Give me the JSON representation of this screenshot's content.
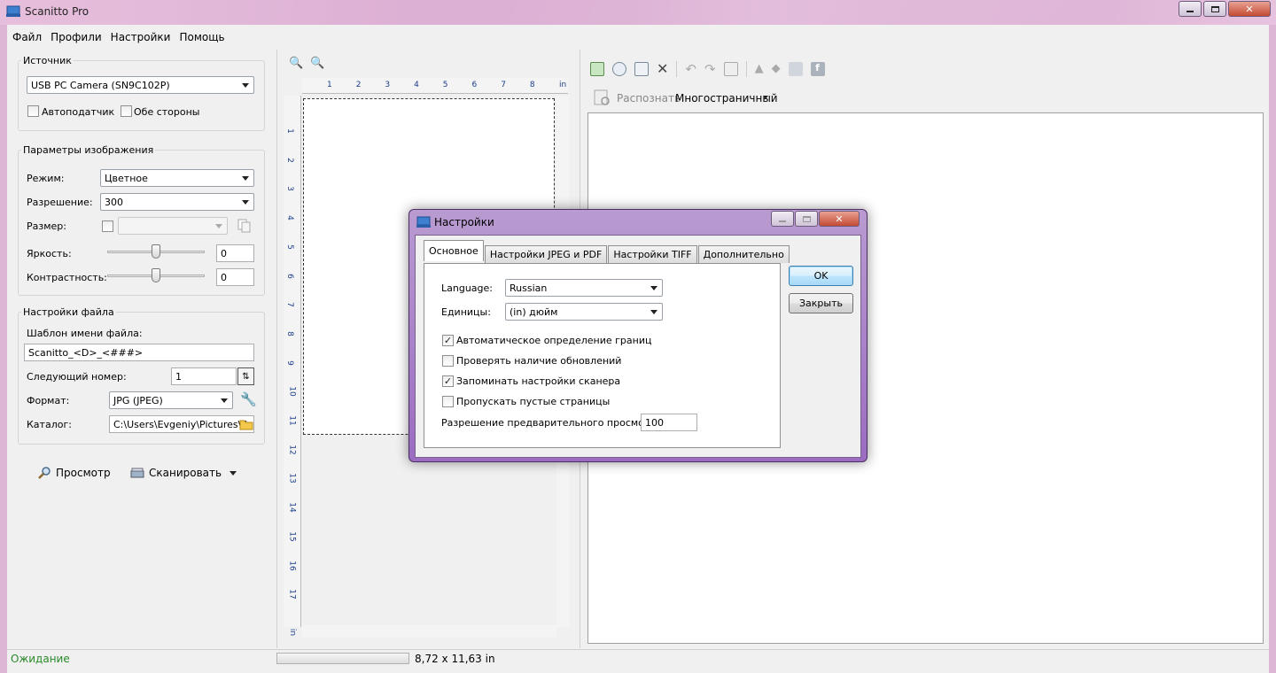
{
  "window": {
    "title": "Scanitto Pro",
    "min": "0",
    "max": "1",
    "close": "r"
  },
  "menu": [
    "Файл",
    "Профили",
    "Настройки",
    "Помощь"
  ],
  "source": {
    "group_label": "Источник",
    "device": "USB PC Camera (SN9C102P)",
    "adf_label": "Автоподатчик",
    "adf_checked": false,
    "duplex_label": "Обе стороны",
    "duplex_checked": false
  },
  "image": {
    "group_label": "Параметры изображения",
    "mode_label": "Режим:",
    "mode_value": "Цветное",
    "res_label": "Разрешение:",
    "res_value": "300",
    "size_label": "Размер:",
    "size_value": "",
    "brightness_label": "Яркость:",
    "brightness_value": "0",
    "contrast_label": "Контрастность:",
    "contrast_value": "0"
  },
  "file": {
    "group_label": "Настройки файла",
    "template_label": "Шаблон имени файла:",
    "template_value": "Scanitto_<D>_<###>",
    "next_label": "Следующий номер:",
    "next_value": "1",
    "format_label": "Формат:",
    "format_value": "JPG (JPEG)",
    "dir_label": "Каталог:",
    "dir_value": "C:\\Users\\Evgeniy\\Pictures\\Sca"
  },
  "actions": {
    "preview": "Просмотр",
    "scan": "Сканировать"
  },
  "ruler": {
    "h": [
      "1",
      "2",
      "3",
      "4",
      "5",
      "6",
      "7",
      "8",
      "in"
    ],
    "v": [
      "1",
      "2",
      "3",
      "4",
      "5",
      "6",
      "7",
      "8",
      "9",
      "10",
      "11",
      "12",
      "13",
      "14",
      "15",
      "16",
      "17"
    ],
    "unit": "in"
  },
  "right": {
    "recognize": "Распознать",
    "multipage": "Многостраничный"
  },
  "status": {
    "text": "Ожидание",
    "size": "8,72 x 11,63 in",
    "progress": 0
  },
  "dialog": {
    "title": "Настройки",
    "tabs": [
      "Основное",
      "Настройки JPEG и PDF",
      "Настройки TIFF",
      "Дополнительно"
    ],
    "language_label": "Language:",
    "language_value": "Russian",
    "units_label": "Единицы:",
    "units_value": "(in) дюйм",
    "checks": [
      {
        "label": "Автоматическое определение границ",
        "checked": true
      },
      {
        "label": "Проверять наличие обновлений",
        "checked": false
      },
      {
        "label": "Запоминать настройки сканера",
        "checked": true
      },
      {
        "label": "Пропускать пустые страницы",
        "checked": false
      }
    ],
    "preview_res_label": "Разрешение предварительного просмотра:",
    "preview_res_value": "100",
    "ok": "OK",
    "close": "Закрыть"
  }
}
